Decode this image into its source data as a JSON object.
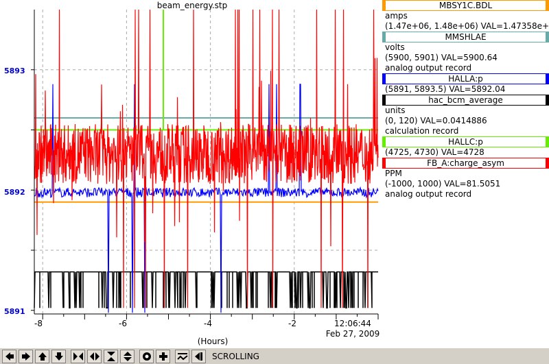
{
  "window": {
    "title": "beam_energy.stp"
  },
  "chart_data": {
    "type": "line",
    "x_unit_label": "(Hours)",
    "x_ticks": [
      "-8",
      "-6",
      "-4",
      "-2"
    ],
    "x_range": [
      -8.2,
      0
    ],
    "y_ticks": [
      "5893",
      "5892",
      "5891"
    ],
    "y_range": [
      5890.97,
      5893.5
    ],
    "time_label": "12:06:44",
    "date_label": "Feb 27, 2009",
    "grid": true,
    "series": [
      {
        "name": "MBSY1C.BDL",
        "color": "#ff9900",
        "level": 5891.9
      },
      {
        "name": "MMSHLAE",
        "color": "#66aaaa",
        "level": 5892.6
      },
      {
        "name": "HALLA:p",
        "color": "#0000ff",
        "level": 5891.98
      },
      {
        "name": "hac_bcm_average",
        "color": "#000000",
        "level": 5891.32
      },
      {
        "name": "HALLC:p",
        "color": "#66ee00",
        "level": 5892.5
      },
      {
        "name": "FB_A:charge_asym",
        "color": "#ff0000",
        "level": 5892.3
      }
    ]
  },
  "legend": [
    {
      "name": "MBSY1C.BDL",
      "color": "#ff9900",
      "lines": [
        "amps",
        "(1.47e+06, 1.48e+06)  VAL=1.47358e+06"
      ]
    },
    {
      "name": "MMSHLAE",
      "color": "#66aaaa",
      "lines": [
        "volts",
        "(5900, 5901)  VAL=5900.64",
        "analog output record"
      ]
    },
    {
      "name": "HALLA:p",
      "color": "#0000ff",
      "lines": [
        "(5891, 5893.5)  VAL=5892.04"
      ]
    },
    {
      "name": "hac_bcm_average",
      "color": "#000000",
      "lines": [
        "units",
        "(0, 120)  VAL=0.0414886",
        "calculation record"
      ]
    },
    {
      "name": "HALLC:p",
      "color": "#66ee00",
      "lines": [
        "(4725, 4730)  VAL=4728"
      ]
    },
    {
      "name": "FB_A:charge_asym",
      "color": "#ff0000",
      "lines": [
        "PPM",
        "(-1000, 1000)  VAL=81.5051",
        "analog output record"
      ]
    }
  ],
  "toolbar": {
    "buttons": [
      "scroll-left-icon",
      "scroll-right-icon",
      "scroll-up-icon",
      "scroll-down-icon",
      "zoom-x-in-icon",
      "zoom-x-out-icon",
      "zoom-y-in-icon",
      "zoom-y-out-icon",
      "autoscale-icon",
      "add-icon",
      "stripchart-icon",
      "export-icon"
    ],
    "mode_label": "SCROLLING"
  }
}
